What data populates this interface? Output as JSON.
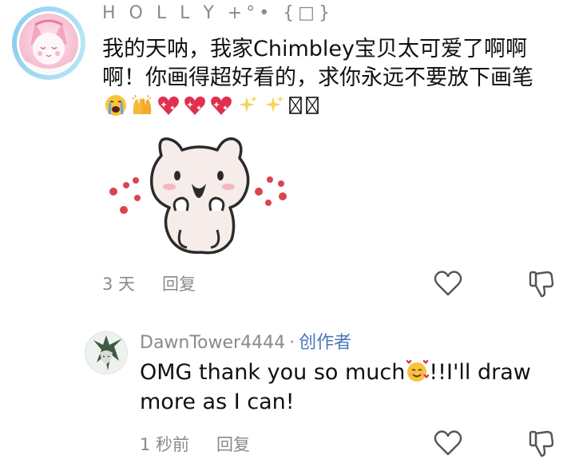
{
  "top_comment": {
    "username": "H O L L Y +°• {□}",
    "text": "我的天呐，我家Chimbley宝贝太可爱了啊啊啊！你画得超好看的，求你永远不要放下画笔",
    "emoji": [
      "loudly-crying-face",
      "raising-hands",
      "sparkling-heart",
      "sparkling-heart",
      "sparkling-heart",
      "sparkles",
      "sparkles",
      "missing-glyph",
      "missing-glyph"
    ],
    "time": "3 天",
    "reply_label": "回复"
  },
  "reply": {
    "username": "DawnTower4444",
    "separator": "·",
    "creator_badge": "创作者",
    "text_before_emoji": "OMG thank you so much",
    "emoji": "smiling-face-with-hearts",
    "text_after_emoji": "!!I'll draw more as I can!",
    "time": "1 秒前",
    "reply_label": "回复"
  },
  "icons": {
    "like": "heart-outline-icon",
    "dislike": "thumbs-down-icon"
  },
  "colors": {
    "text_primary": "#111111",
    "text_secondary": "#8a8a8a",
    "creator_badge": "#4a78b8",
    "avatar_ring": "#9fd7f5"
  }
}
